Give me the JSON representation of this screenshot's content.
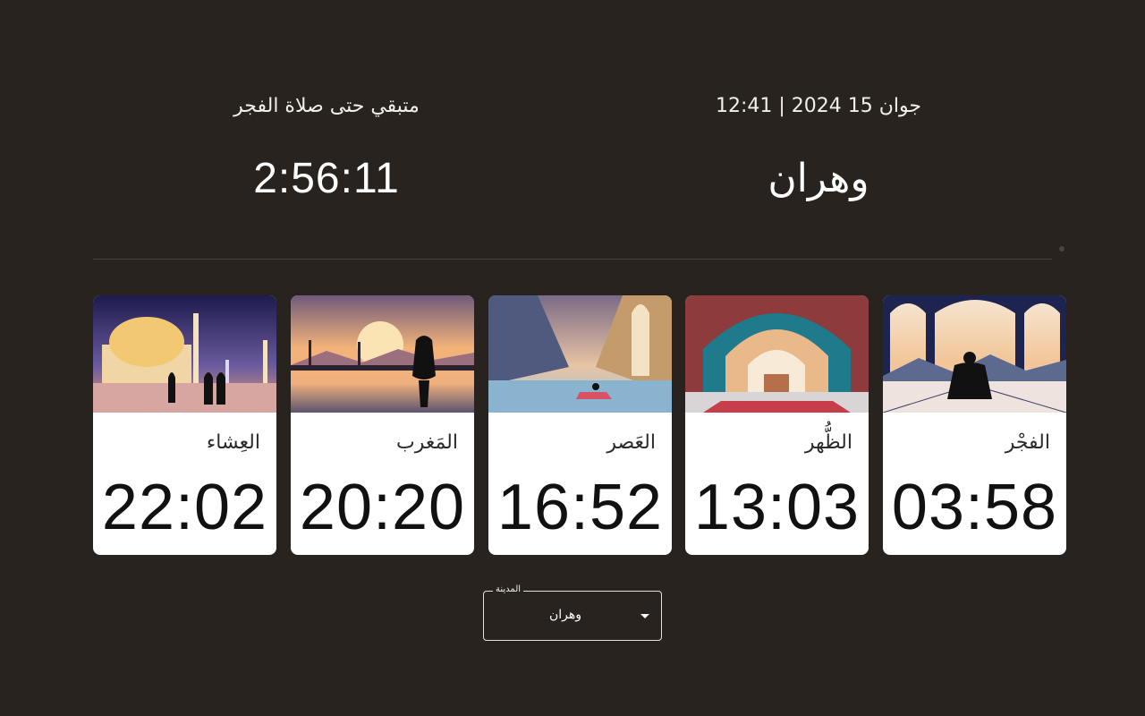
{
  "header": {
    "date_time": "جوان 15 2024 | 12:41",
    "city": "وهران",
    "remaining_label": "متبقي حتى صلاة الفجر",
    "countdown": "2:56:11"
  },
  "prayers": [
    {
      "name": "العِشاء",
      "time": "22:02",
      "image": "mosque-night-image"
    },
    {
      "name": "المَغرب",
      "time": "20:20",
      "image": "sunset-silhouette-image"
    },
    {
      "name": "العَصر",
      "time": "16:52",
      "image": "arches-corridor-image"
    },
    {
      "name": "الظُّهر",
      "time": "13:03",
      "image": "mosque-interior-image"
    },
    {
      "name": "الفجْر",
      "time": "03:58",
      "image": "dawn-prayer-image"
    }
  ],
  "city_select": {
    "label": "المدينة",
    "value": "وهران"
  },
  "colors": {
    "background": "#28231e",
    "card": "#ffffff",
    "text_dark": "#111111"
  }
}
